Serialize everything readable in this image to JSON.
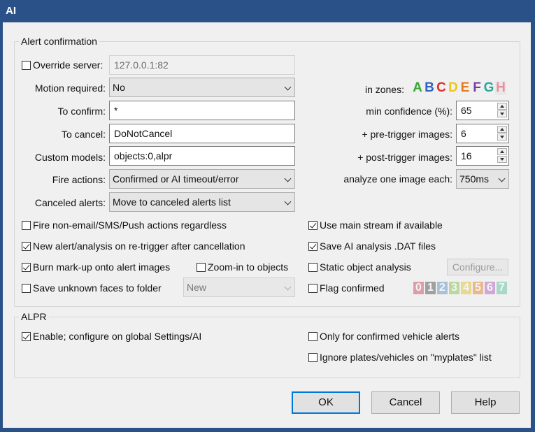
{
  "window": {
    "title": "AI"
  },
  "alert_group": {
    "legend": "Alert confirmation",
    "override_server": {
      "label": "Override server:",
      "checked": false,
      "value": "127.0.0.1:82"
    },
    "motion_required": {
      "label": "Motion required:",
      "value": "No"
    },
    "to_confirm": {
      "label": "To confirm:",
      "value": "*"
    },
    "to_cancel": {
      "label": "To cancel:",
      "value": "DoNotCancel"
    },
    "custom_models": {
      "label": "Custom models:",
      "value": "objects:0,alpr"
    },
    "fire_actions": {
      "label": "Fire actions:",
      "value": "Confirmed or AI timeout/error"
    },
    "canceled_alerts": {
      "label": "Canceled alerts:",
      "value": "Move to canceled alerts list"
    },
    "in_zones": {
      "label": "in zones:",
      "zones": [
        "A",
        "B",
        "C",
        "D",
        "E",
        "F",
        "G",
        "H"
      ],
      "colors": [
        "#3aa635",
        "#2e63c0",
        "#d8342c",
        "#f0c419",
        "#e27b1f",
        "#7d3ba0",
        "#28a89a",
        "#e890a0"
      ]
    },
    "min_confidence": {
      "label": "min confidence (%):",
      "value": "65"
    },
    "pre_trigger": {
      "label": "+ pre-trigger images:",
      "value": "6"
    },
    "post_trigger": {
      "label": "+ post-trigger images:",
      "value": "16"
    },
    "analyze_each": {
      "label": "analyze one image each:",
      "value": "750ms"
    },
    "fire_non_email": {
      "label": "Fire non-email/SMS/Push actions regardless",
      "checked": false
    },
    "new_alert_retrigger": {
      "label": "New alert/analysis on re-trigger after cancellation",
      "checked": true
    },
    "burn_markup": {
      "label": "Burn mark-up onto alert images",
      "checked": true
    },
    "zoom_in": {
      "label": "Zoom-in to objects",
      "checked": false
    },
    "save_unknown_faces": {
      "label": "Save unknown faces to folder",
      "checked": false,
      "folder": "New"
    },
    "use_main_stream": {
      "label": "Use main stream if available",
      "checked": true
    },
    "save_dat": {
      "label": "Save AI analysis .DAT files",
      "checked": true
    },
    "static_object": {
      "label": "Static object analysis",
      "checked": false,
      "configure_label": "Configure..."
    },
    "flag_confirmed": {
      "label": "Flag confirmed",
      "checked": false,
      "flags": [
        "0",
        "1",
        "2",
        "3",
        "4",
        "5",
        "6",
        "7"
      ],
      "flag_colors": [
        "#d9a0a8",
        "#a0a0a0",
        "#a8c0d8",
        "#bcd8a0",
        "#e8d890",
        "#e8b890",
        "#d0a8d8",
        "#a8d8c8"
      ]
    }
  },
  "alpr_group": {
    "legend": "ALPR",
    "enable": {
      "label": "Enable; configure on global Settings/AI",
      "checked": true
    },
    "only_vehicle": {
      "label": "Only for confirmed vehicle alerts",
      "checked": false
    },
    "ignore_plates": {
      "label": "Ignore plates/vehicles on \"myplates\" list",
      "checked": false
    }
  },
  "buttons": {
    "ok": "OK",
    "cancel": "Cancel",
    "help": "Help"
  }
}
